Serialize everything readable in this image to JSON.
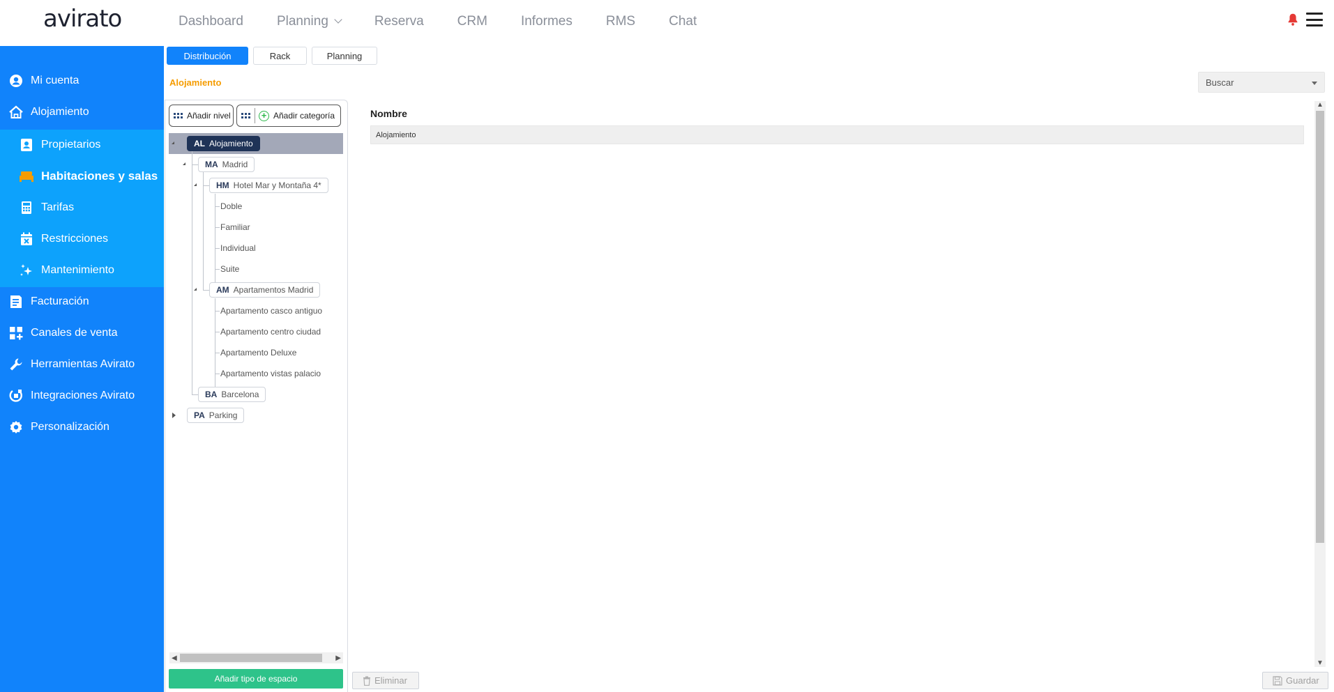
{
  "app": {
    "logo": "avirato"
  },
  "topnav": [
    {
      "label": "Dashboard",
      "has_dropdown": false
    },
    {
      "label": "Planning",
      "has_dropdown": true
    },
    {
      "label": "Reserva",
      "has_dropdown": false
    },
    {
      "label": "CRM",
      "has_dropdown": false
    },
    {
      "label": "Informes",
      "has_dropdown": false
    },
    {
      "label": "RMS",
      "has_dropdown": false
    },
    {
      "label": "Chat",
      "has_dropdown": false
    }
  ],
  "header_icons": {
    "notification": "bell-icon",
    "menu": "hamburger-menu-icon",
    "notification_color": "#e53935"
  },
  "sidebar": {
    "bg_color": "#1183fb",
    "sub_bg_color": "#0da2fc",
    "items": [
      {
        "label": "Mi cuenta",
        "icon": "user-circle-icon"
      },
      {
        "label": "Alojamiento",
        "icon": "house-icon"
      },
      {
        "label": "Facturación",
        "icon": "invoice-icon"
      },
      {
        "label": "Canales de venta",
        "icon": "grid-plus-icon"
      },
      {
        "label": "Herramientas Avirato",
        "icon": "wrench-icon"
      },
      {
        "label": "Integraciones Avirato",
        "icon": "integration-icon"
      },
      {
        "label": "Personalización",
        "icon": "gear-icon"
      }
    ],
    "subitems": [
      {
        "label": "Propietarios",
        "icon": "owner-card-icon"
      },
      {
        "label": "Habitaciones y salas",
        "icon": "bed-icon",
        "active": true,
        "icon_color": "#f59c00"
      },
      {
        "label": "Tarifas",
        "icon": "calculator-icon"
      },
      {
        "label": "Restricciones",
        "icon": "calendar-x-icon"
      },
      {
        "label": "Mantenimiento",
        "icon": "sparkle-icon"
      }
    ]
  },
  "tabs": [
    {
      "label": "Distribución",
      "active": true
    },
    {
      "label": "Rack",
      "active": false
    },
    {
      "label": "Planning",
      "active": false
    }
  ],
  "breadcrumb": "Alojamiento",
  "search": {
    "label": "Buscar"
  },
  "tree_toolbar": {
    "add_level": "Añadir nivel",
    "add_category": "Añadir categoría"
  },
  "tree": {
    "root": {
      "code": "AL",
      "label": "Alojamiento"
    },
    "madrid": {
      "code": "MA",
      "label": "Madrid"
    },
    "hotel": {
      "code": "HM",
      "label": "Hotel Mar y Montaña 4*"
    },
    "hotel_rooms": [
      "Doble",
      "Familiar",
      "Individual",
      "Suite"
    ],
    "apartments": {
      "code": "AM",
      "label": "Apartamentos Madrid"
    },
    "apartment_units": [
      "Apartamento casco antiguo",
      "Apartamento centro ciudad",
      "Apartamento Deluxe",
      "Apartamento vistas palacio"
    ],
    "barcelona": {
      "code": "BA",
      "label": "Barcelona"
    },
    "parking": {
      "code": "PA",
      "label": "Parking"
    }
  },
  "add_space_type": "Añadir tipo de espacio",
  "form": {
    "name_label": "Nombre",
    "name_value": "Alojamiento"
  },
  "actions": {
    "delete": "Eliminar",
    "save": "Guardar"
  },
  "colors": {
    "accent": "#1183fb",
    "breadcrumb": "#f59c00",
    "add_button": "#2ec38a",
    "selected_node": "#1f3357"
  }
}
